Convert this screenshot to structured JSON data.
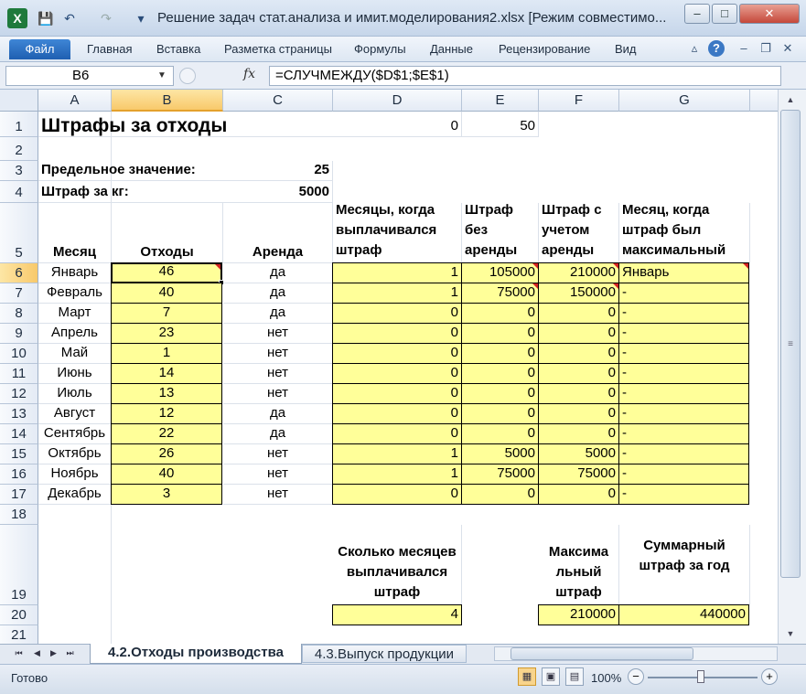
{
  "window": {
    "title": "Решение задач стат.анализа и имит.моделирования2.xlsx  [Режим совместимо...",
    "app_icon": "X",
    "qa_save": "💾",
    "qa_undo": "↶",
    "qa_redo": "↷",
    "qa_custom": "▾",
    "minimize": "–",
    "maximize": "□",
    "close": "✕"
  },
  "ribbon": {
    "tabs": [
      "Файл",
      "Главная",
      "Вставка",
      "Разметка страницы",
      "Формулы",
      "Данные",
      "Рецензирование",
      "Вид"
    ],
    "help": "?"
  },
  "formula_bar": {
    "name_box": "B6",
    "fx": "fx",
    "formula": "=СЛУЧМЕЖДУ($D$1;$E$1)"
  },
  "grid": {
    "columns": [
      "A",
      "B",
      "C",
      "D",
      "E",
      "F",
      "G"
    ],
    "rows": [
      "1",
      "2",
      "3",
      "4",
      "5",
      "6",
      "7",
      "8",
      "9",
      "10",
      "11",
      "12",
      "13",
      "14",
      "15",
      "16",
      "17",
      "18",
      "19",
      "20",
      "21"
    ],
    "title": "Штрафы за отходы",
    "d1": "0",
    "e1": "50",
    "limit_label": "Предельное значение:",
    "limit_value": "25",
    "fine_label": "Штраф за кг:",
    "fine_value": "5000",
    "headers": {
      "month": "Месяц",
      "waste": "Отходы",
      "rent": "Аренда",
      "fine_months": "Месяцы, когда выплачивался штраф",
      "fine_no_rent": "Штраф без аренды",
      "fine_with_rent": "Штраф с учетом аренды",
      "max_month": "Месяц, когда штраф был максимальный"
    },
    "data": [
      {
        "month": "Январь",
        "waste": "46",
        "rent": "да",
        "paid": "1",
        "fine": "105000",
        "fine_rent": "210000",
        "max": "Январь"
      },
      {
        "month": "Февраль",
        "waste": "40",
        "rent": "да",
        "paid": "1",
        "fine": "75000",
        "fine_rent": "150000",
        "max": "-"
      },
      {
        "month": "Март",
        "waste": "7",
        "rent": "да",
        "paid": "0",
        "fine": "0",
        "fine_rent": "0",
        "max": "-"
      },
      {
        "month": "Апрель",
        "waste": "23",
        "rent": "нет",
        "paid": "0",
        "fine": "0",
        "fine_rent": "0",
        "max": "-"
      },
      {
        "month": "Май",
        "waste": "1",
        "rent": "нет",
        "paid": "0",
        "fine": "0",
        "fine_rent": "0",
        "max": "-"
      },
      {
        "month": "Июнь",
        "waste": "14",
        "rent": "нет",
        "paid": "0",
        "fine": "0",
        "fine_rent": "0",
        "max": "-"
      },
      {
        "month": "Июль",
        "waste": "13",
        "rent": "нет",
        "paid": "0",
        "fine": "0",
        "fine_rent": "0",
        "max": "-"
      },
      {
        "month": "Август",
        "waste": "12",
        "rent": "да",
        "paid": "0",
        "fine": "0",
        "fine_rent": "0",
        "max": "-"
      },
      {
        "month": "Сентябрь",
        "waste": "22",
        "rent": "да",
        "paid": "0",
        "fine": "0",
        "fine_rent": "0",
        "max": "-"
      },
      {
        "month": "Октябрь",
        "waste": "26",
        "rent": "нет",
        "paid": "1",
        "fine": "5000",
        "fine_rent": "5000",
        "max": "-"
      },
      {
        "month": "Ноябрь",
        "waste": "40",
        "rent": "нет",
        "paid": "1",
        "fine": "75000",
        "fine_rent": "75000",
        "max": "-"
      },
      {
        "month": "Декабрь",
        "waste": "3",
        "rent": "нет",
        "paid": "0",
        "fine": "0",
        "fine_rent": "0",
        "max": "-"
      }
    ],
    "summary": {
      "months_count_label": "Сколько месяцев выплачивался штраф",
      "months_count_value": "4",
      "max_fine_label": "Максима льный штраф",
      "max_fine_value": "210000",
      "total_label": "Суммарный штраф за год",
      "total_value": "440000"
    }
  },
  "sheet_tabs": {
    "nav": [
      "⏮",
      "◀",
      "▶",
      "⏭"
    ],
    "tabs": [
      "4.2.Отходы производства",
      "4.3.Выпуск продукции"
    ]
  },
  "status_bar": {
    "status": "Готово",
    "zoom": "100%",
    "zoom_minus": "−",
    "zoom_plus": "+"
  },
  "colors": {
    "input_fill": "#ffff99",
    "selected_header": "#f8c96b",
    "file_tab": "#1f5fb1"
  }
}
